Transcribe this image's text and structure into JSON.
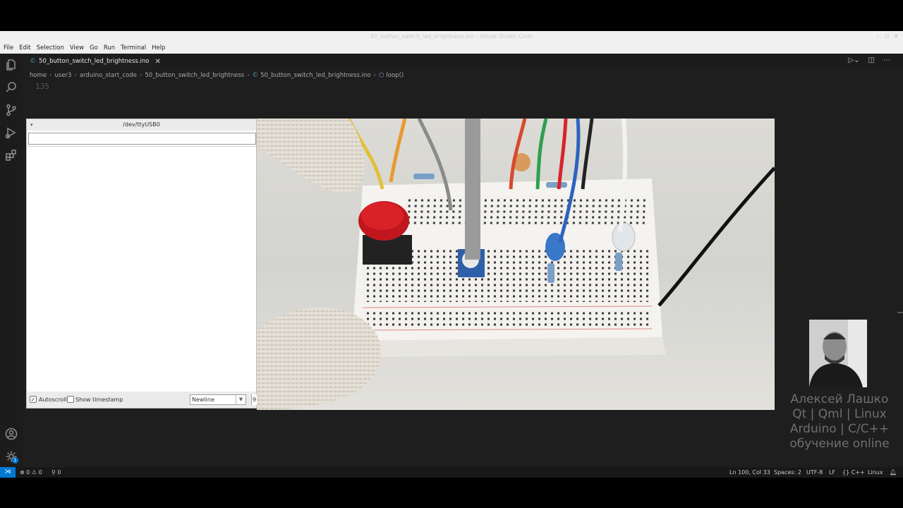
{
  "window": {
    "title": "50_button_switch_led_brightness.ino - Visual Studio Code"
  },
  "menu": [
    "File",
    "Edit",
    "Selection",
    "View",
    "Go",
    "Run",
    "Terminal",
    "Help"
  ],
  "tab": {
    "label": "50_button_switch_led_brightness.ino"
  },
  "breadcrumbs": [
    "home",
    "user3",
    "arduino_start_code",
    "50_button_switch_led_brightness",
    "50_button_switch_led_brightness.ino",
    "loop()"
  ],
  "editor": {
    "visible_line_number": "135"
  },
  "serial_monitor": {
    "title": "/dev/ttyUSB0",
    "input_value": "",
    "autoscroll_label": "Autoscroll",
    "autoscroll_checked": true,
    "timestamp_label": "Show timestamp",
    "timestamp_checked": false,
    "line_ending": "Newline",
    "baud_partial": "9"
  },
  "watermark": {
    "lines": [
      "Алексей Лашко",
      "Qt | Qml | Linux",
      "Arduino | C/C++",
      "обучение online"
    ]
  },
  "statusbar": {
    "errors": "0",
    "warnings": "0",
    "ports": "0",
    "cursor": "Ln 100, Col 33",
    "spaces": "Spaces: 2",
    "encoding": "UTF-8",
    "eol": "LF",
    "language": "C++",
    "platform": "Linux"
  },
  "accounts_badge": "1",
  "colors": {
    "accent": "#0078d4",
    "editor_bg": "#1e1e1e"
  }
}
